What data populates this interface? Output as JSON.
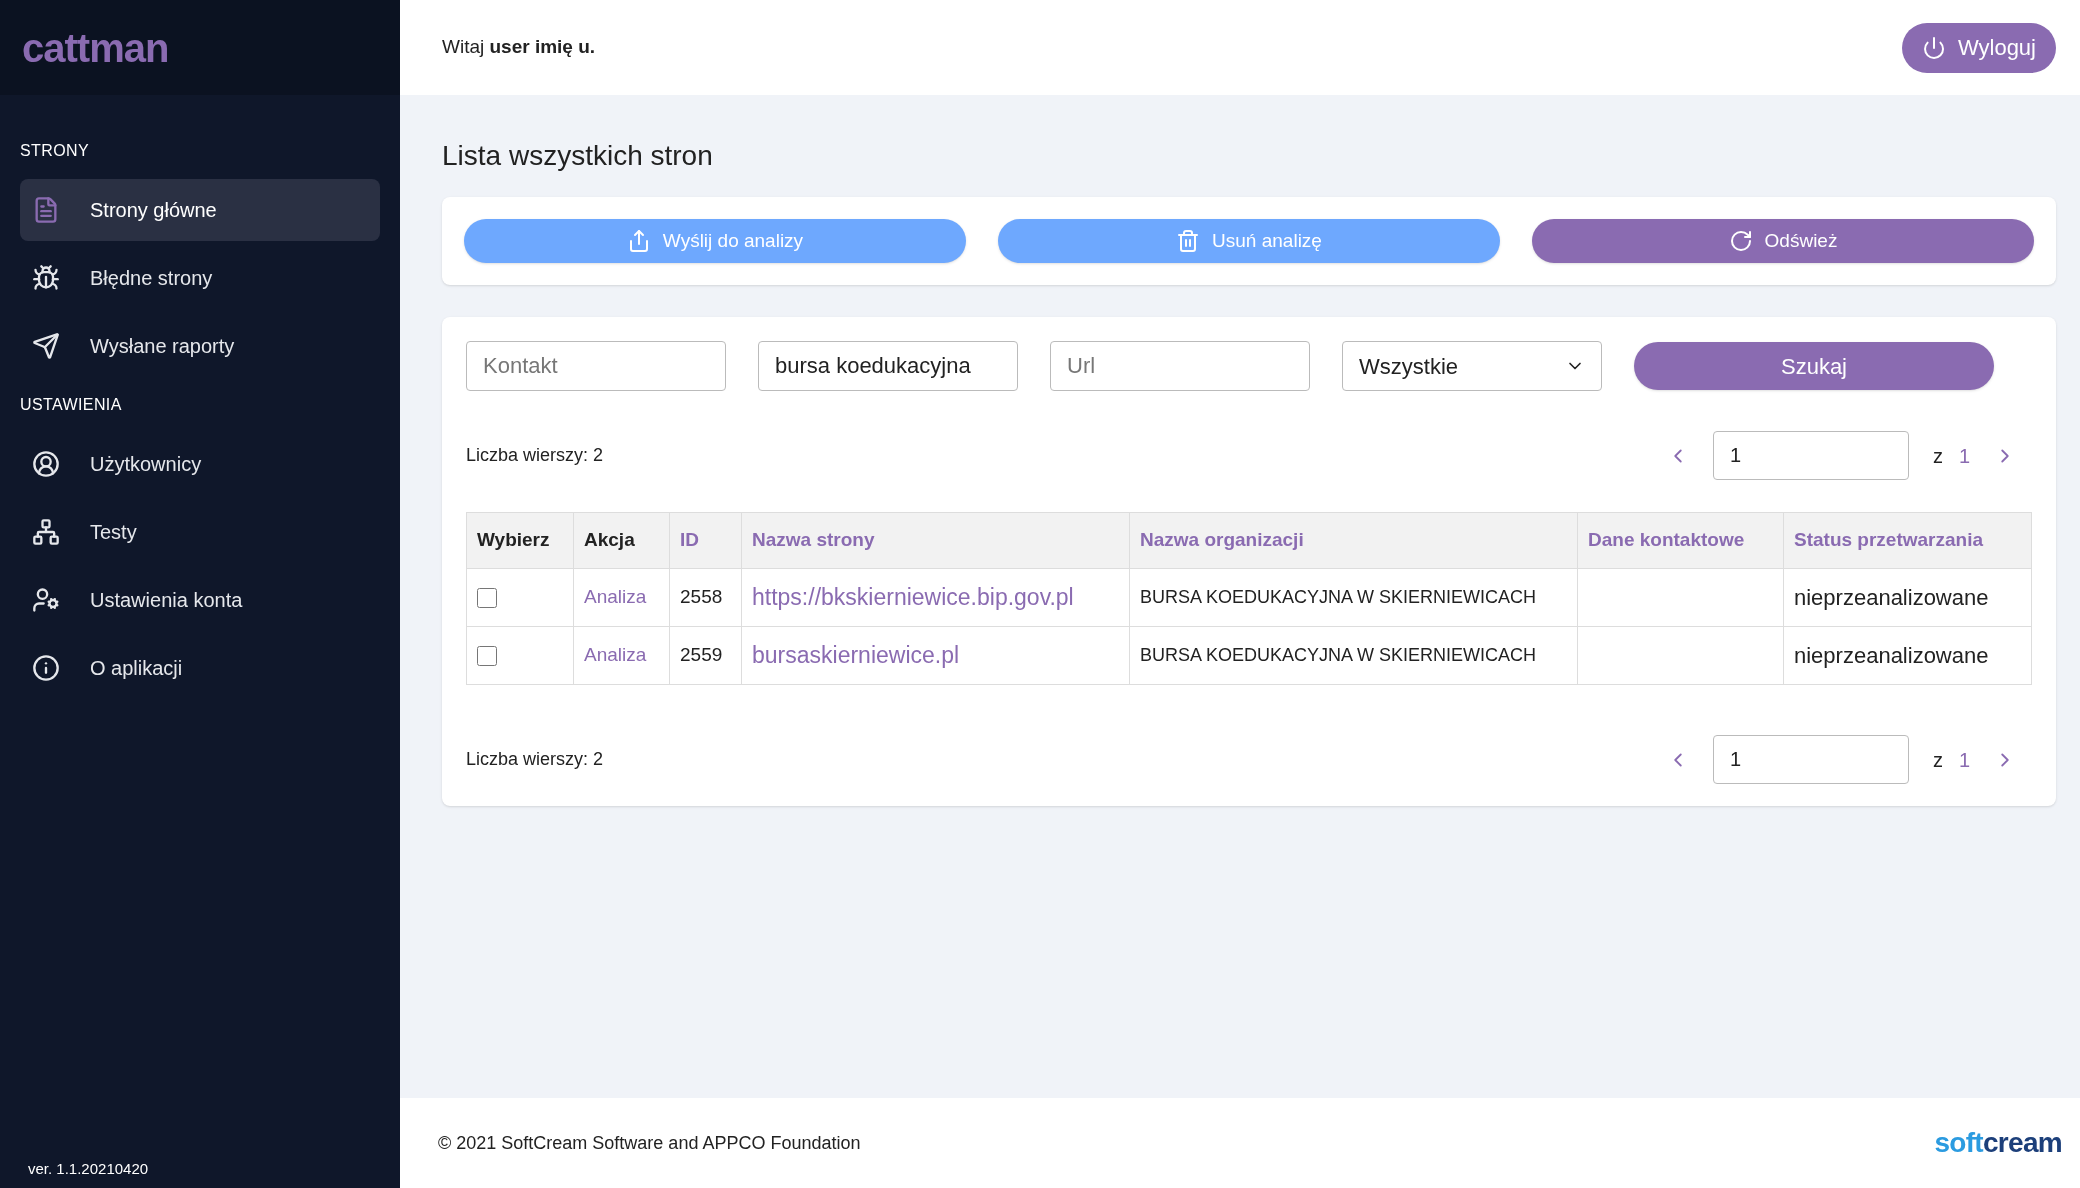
{
  "sidebar": {
    "logo": "cattman",
    "sections": [
      {
        "title": "STRONY",
        "items": [
          {
            "label": "Strony główne",
            "selected": true
          },
          {
            "label": "Błędne strony",
            "selected": false
          },
          {
            "label": "Wysłane raporty",
            "selected": false
          }
        ]
      },
      {
        "title": "USTAWIENIA",
        "items": [
          {
            "label": "Użytkownicy",
            "selected": false
          },
          {
            "label": "Testy",
            "selected": false
          },
          {
            "label": "Ustawienia konta",
            "selected": false
          },
          {
            "label": "O aplikacji",
            "selected": false
          }
        ]
      }
    ],
    "version": "ver. 1.1.20210420"
  },
  "header": {
    "greeting": "Witaj **user imię u.**",
    "logout": "Wyloguj"
  },
  "page_title": "Lista wszystkich stron",
  "actions": [
    {
      "label": "Wyślij do analizy",
      "kind": "primary"
    },
    {
      "label": "Usuń analizę",
      "kind": "primary"
    },
    {
      "label": "Odśwież",
      "kind": "secondary"
    }
  ],
  "filters": {
    "contact": {
      "placeholder": "Kontakt"
    },
    "name": {
      "value": "bursa koedukacyjna"
    },
    "url": {
      "placeholder": "Url"
    },
    "status": {
      "value": "Wszystkie"
    },
    "search_button": "Szukaj"
  },
  "pagination_top": {
    "rows_label": "Liczba wierszy: 2",
    "page": "1",
    "of": "z",
    "total": "1"
  },
  "table": {
    "columns": [
      {
        "label": "Wybierz",
        "sortable": false
      },
      {
        "label": "Akcja",
        "sortable": false
      },
      {
        "label": "ID",
        "sortable": true
      },
      {
        "label": "Nazwa strony",
        "sortable": true
      },
      {
        "label": "Nazwa organizacji",
        "sortable": true
      },
      {
        "label": "Dane kontaktowe",
        "sortable": true
      },
      {
        "label": "Status przetwarzania",
        "sortable": true
      }
    ],
    "rows": [
      {
        "checked": false,
        "action": "Analiza",
        "id": "2558",
        "site": "https://bkskierniewice.bip.gov.pl",
        "org": "BURSA KOEDUKACYJNA W SKIERNIEWICACH",
        "status": "nieprzeanalizowane"
      },
      {
        "checked": false,
        "action": "Analiza",
        "id": "2559",
        "site": "bursaskierniewice.pl",
        "org": "BURSA KOEDUKACYJNA W SKIERNIEWICACH",
        "status": "nieprzeanalizowane"
      }
    ]
  },
  "pagination_bottom": {
    "rows_label": "Liczba wierszy: 2",
    "page": "1",
    "of": "z",
    "total": "1"
  },
  "footer": {
    "copyright": "© 2021 SoftCream Software and APPCO Foundation",
    "brand_part_1": "soft",
    "brand_part_2": "cream"
  }
}
